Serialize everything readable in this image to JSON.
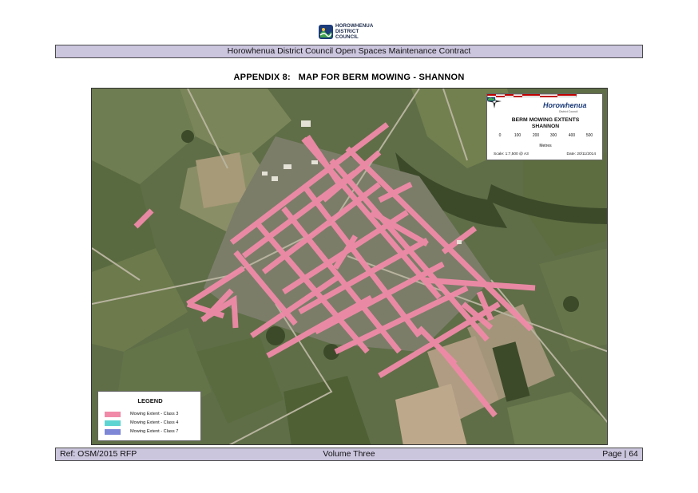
{
  "logo": {
    "icon": "horowhenua-logo-icon",
    "line1": "HOROWHENUA",
    "line2": "DISTRICT",
    "line3": "COUNCIL"
  },
  "header": {
    "text": "Horowhenua District Council Open Spaces Maintenance Contract"
  },
  "title": {
    "appendix": "APPENDIX 8:",
    "map_title": "MAP FOR BERM MOWING - SHANNON"
  },
  "map": {
    "info_box": {
      "brand": "Horowhenua",
      "brand_sub": "District Council",
      "title_line1": "BERM MOWING EXTENTS",
      "title_line2": "SHANNON",
      "scale_ticks": [
        "0",
        "100",
        "200",
        "300",
        "400",
        "500"
      ],
      "units": "Metres",
      "scale": "Scale: 1:7,500 @ A3",
      "date": "Date: 20/11/2014"
    },
    "legend": {
      "title": "LEGEND",
      "items": [
        {
          "label": "Mowing Extent - Class 3",
          "color": "#f08aa8"
        },
        {
          "label": "Mowing Extent - Class 4",
          "color": "#5ed4d2"
        },
        {
          "label": "Mowing Extent - Class 7",
          "color": "#7e86d6"
        }
      ]
    }
  },
  "footer": {
    "ref": "Ref: OSM/2015 RFP",
    "volume": "Volume Three",
    "page": "Page | 64"
  },
  "colors": {
    "bar_fill": "#ccc5de",
    "mowing_class_3": "#f08aa8",
    "scale_red": "#c00000"
  }
}
